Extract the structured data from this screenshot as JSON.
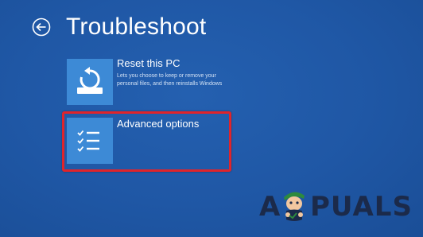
{
  "header": {
    "back_icon": "back-arrow-icon",
    "title": "Troubleshoot"
  },
  "options": [
    {
      "id": "reset",
      "icon": "reset-pc-icon",
      "title": "Reset this PC",
      "description": "Lets you choose to keep or remove your personal files, and then reinstalls Windows"
    },
    {
      "id": "advanced",
      "icon": "checklist-icon",
      "title": "Advanced options",
      "highlighted": true
    }
  ],
  "watermark": {
    "text_left": "A",
    "text_right": "PUALS"
  },
  "colors": {
    "background": "#1f58a6",
    "tile": "#3d8ad6",
    "highlight": "#e0242b"
  }
}
